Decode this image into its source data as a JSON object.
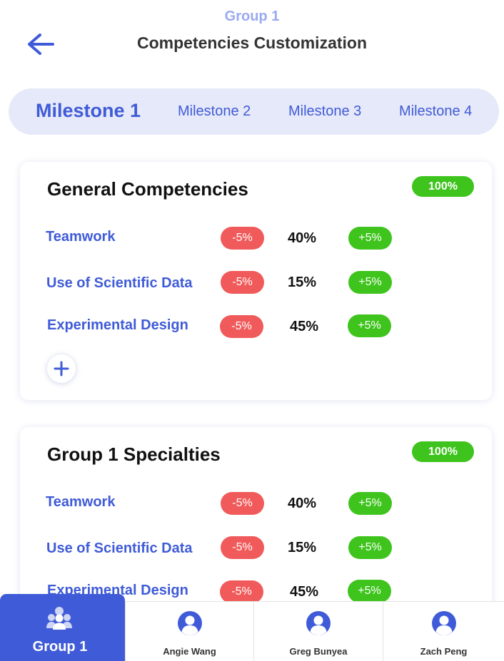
{
  "header": {
    "subtitle": "Group 1",
    "title": "Competencies Customization"
  },
  "icons": {
    "back": "arrow-left-icon",
    "add": "plus-icon",
    "group": "group-users-icon",
    "user": "user-avatar-icon"
  },
  "colors": {
    "accent": "#3f5bd7",
    "positive": "#3ec41d",
    "negative": "#f15a5a",
    "tab_bar_bg": "#e6e9f9"
  },
  "milestones": {
    "active_index": 0,
    "tabs": [
      "Milestone 1",
      "Milestone 2",
      "Milestone 3",
      "Milestone 4"
    ]
  },
  "sections": [
    {
      "title": "General Competencies",
      "total": "100%",
      "rows": [
        {
          "label": "Teamwork",
          "minus": "-5%",
          "value": "40%",
          "plus": "+5%"
        },
        {
          "label": "Use of Scientific Data",
          "minus": "-5%",
          "value": "15%",
          "plus": "+5%"
        },
        {
          "label": "Experimental Design",
          "minus": "-5%",
          "value": "45%",
          "plus": "+5%"
        }
      ]
    },
    {
      "title": "Group 1 Specialties",
      "total": "100%",
      "rows": [
        {
          "label": "Teamwork",
          "minus": "-5%",
          "value": "40%",
          "plus": "+5%"
        },
        {
          "label": "Use of Scientific Data",
          "minus": "-5%",
          "value": "15%",
          "plus": "+5%"
        },
        {
          "label": "Experimental Design",
          "minus": "-5%",
          "value": "45%",
          "plus": "+5%"
        }
      ]
    }
  ],
  "bottom_nav": {
    "active_label": "Group 1",
    "items": [
      "Angie Wang",
      "Greg Bunyea",
      "Zach Peng"
    ]
  }
}
